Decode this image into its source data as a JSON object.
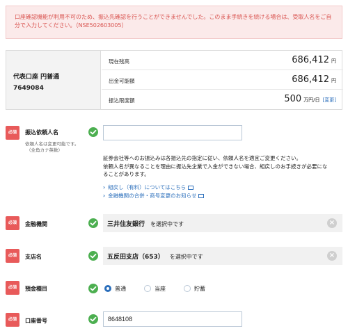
{
  "alert": {
    "line1": "口座確認機能が利用不可のため、振込先確認を行うことができませんでした。このまま手続きを続ける場合は、受取人名をご自",
    "line2": "分で入力してください。（NSE502603005）"
  },
  "account": {
    "name": "代表口座 円普通",
    "number": "7649084",
    "rows": [
      {
        "label": "現在残高",
        "value": "686,412",
        "unit": "円",
        "link": ""
      },
      {
        "label": "出金可能額",
        "value": "686,412",
        "unit": "円",
        "link": ""
      },
      {
        "label": "振込限度額",
        "value": "500",
        "unit": "万円/日",
        "link": "[変更]"
      }
    ]
  },
  "required_badge": "必須",
  "fields": {
    "requester": {
      "label": "振込依頼人名",
      "note1": "依頼人名は変更可能です。",
      "note2": "（全角カナ英数）",
      "value": ""
    },
    "info_lines": [
      "証券会社等へのお振込みは各振込先の指定に従い、依頼人名を適宜ご変更ください。",
      "依頼人名が異なることを理由に振込先企業で入金ができない場合、組戻しのお手続きが必要にな",
      "ることがあります。"
    ],
    "links": [
      "組戻し（有料）についてはこちら",
      "金融機関の合併・商号変更のお知らせ"
    ],
    "bank": {
      "label": "金融機関",
      "value": "三井住友銀行",
      "suffix": "を選択中です"
    },
    "branch": {
      "label": "支店名",
      "value": "五反田支店（653）",
      "suffix": "を選択中です"
    },
    "deposit_type": {
      "label": "預金種目",
      "options": [
        "普通",
        "当座",
        "貯蓄"
      ],
      "selected": "普通"
    },
    "account_number": {
      "label": "口座番号",
      "value": "8648108"
    }
  }
}
